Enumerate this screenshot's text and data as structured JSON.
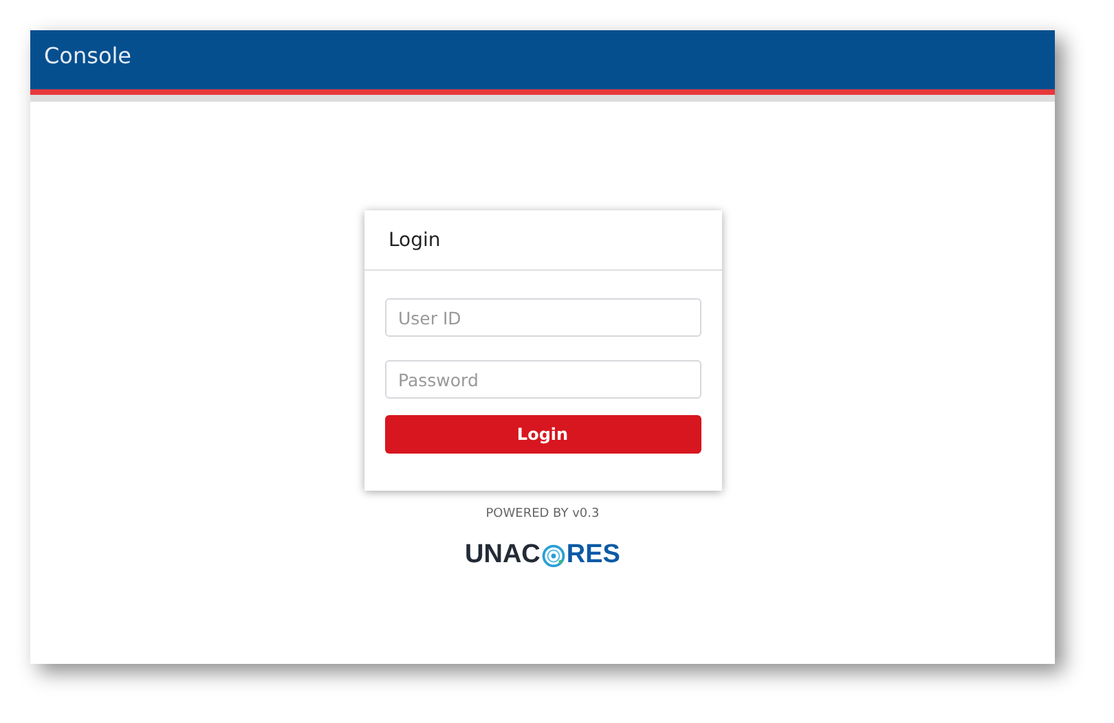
{
  "header": {
    "title": "Console"
  },
  "login_card": {
    "title": "Login",
    "fields": [
      {
        "placeholder": "User ID"
      },
      {
        "placeholder": "Password"
      }
    ],
    "button": "Login"
  },
  "footer": {
    "powered_by": "POWERED BY v0.3",
    "logo": {
      "before": "UNAC",
      "after": "RES"
    }
  }
}
